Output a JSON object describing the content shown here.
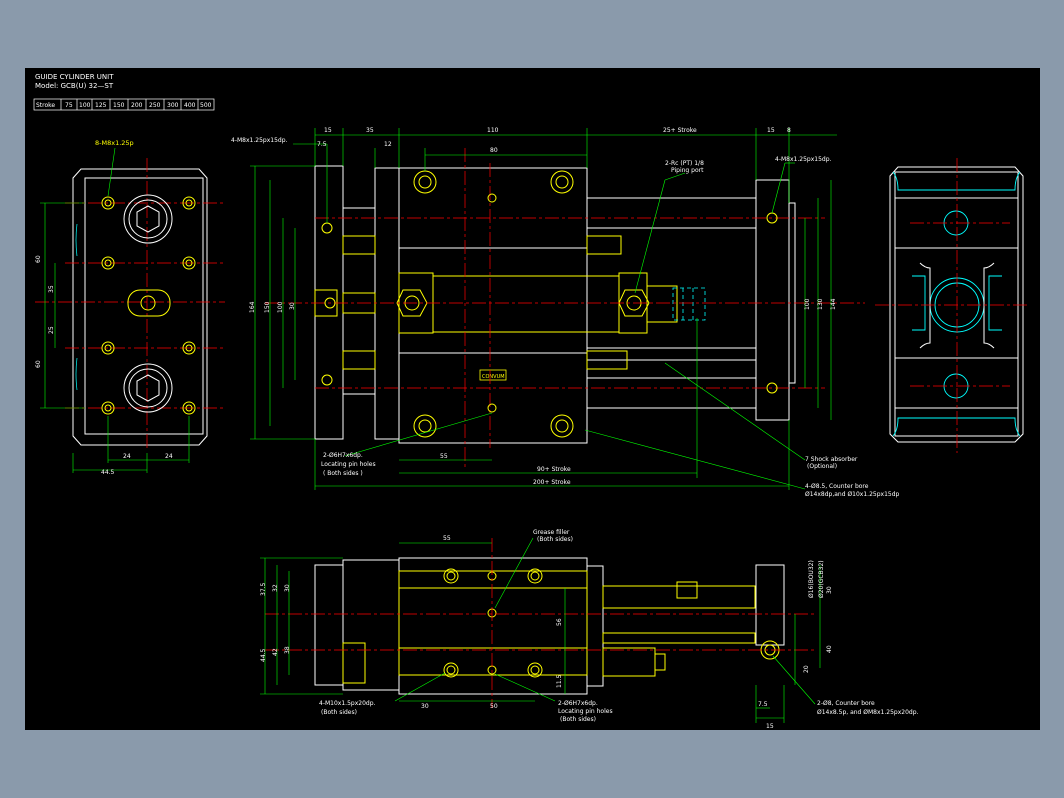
{
  "title": {
    "line1": "GUIDE CYLINDER UNIT",
    "line2": "Model: GCB(U) 32—ST"
  },
  "stroke_table": {
    "label": "Stroke",
    "values": [
      "75",
      "100",
      "125",
      "150",
      "200",
      "250",
      "300",
      "400",
      "500"
    ]
  },
  "left_view": {
    "callout": "8-M8x1.25p",
    "dims": {
      "d60a": "60",
      "d35": "35",
      "d25": "25",
      "d60b": "60",
      "d24a": "24",
      "d24b": "24",
      "d445": "44.5"
    }
  },
  "top_view": {
    "dims": {
      "d15": "15",
      "d35": "35",
      "d110": "110",
      "d25st": "25+ Stroke",
      "d15r": "15",
      "d8": "8",
      "d75": "7.5",
      "d12": "12",
      "d80": "80",
      "d164": "164",
      "d150": "150",
      "d100": "100",
      "d30": "30",
      "d55": "55",
      "d100r": "100",
      "d130": "130",
      "d144": "144",
      "d90st": "90+ Stroke",
      "d200st": "200+ Stroke"
    },
    "callouts": {
      "holes_tl": "4-M8x1.25px15dp.",
      "holes_tr": "4-M8x1.25px15dp.",
      "port_a": "2-Rc (PT) 1/8",
      "port_b": "Piping port",
      "pin_a": "2-Ø6H7x6dp.",
      "pin_b": "Locating pin holes",
      "pin_c": "( Both sides )",
      "absorber_a": "7 Shock absorber",
      "absorber_b": "(Optional)",
      "cbore_a": "4-Ø8.5, Counter bore",
      "cbore_b": "Ø14x8dp,and Ø10x1.25px15dp"
    },
    "label_plate": "CONVUM"
  },
  "front_view": {
    "dims": {
      "d55": "55",
      "d375": "37.5",
      "d32": "32",
      "d30a": "30",
      "d445": "44.5",
      "d42": "42",
      "d38": "38",
      "d56": "56",
      "d115": "11.5",
      "d30b": "30",
      "d50": "50",
      "d16": "Ø16(BOU32)",
      "d20": "Ø20(GCB32)",
      "d30c": "30",
      "d40": "40",
      "d20b": "20",
      "d75": "7.5",
      "d15": "15"
    },
    "callouts": {
      "grease_a": "Grease filler",
      "grease_b": "(Both sides)",
      "m10_a": "4-M10x1.5px20dp.",
      "m10_b": "(Both sides)",
      "pin_a": "2-Ø6H7x6dp.",
      "pin_b": "Locating pin holes",
      "pin_c": "(Both sides)",
      "cbore_a": "2-Ø8, Counter bore",
      "cbore_b": "Ø14x8.5p, and ØM8x1.25px20dp."
    }
  },
  "colors": {
    "background": "#000000",
    "frame": "#8a9aab",
    "part_outline": "#ffffff",
    "dimension": "#00ff00",
    "centerline": "#ff0000",
    "hole": "#ffff00",
    "hidden": "#00ffff"
  }
}
